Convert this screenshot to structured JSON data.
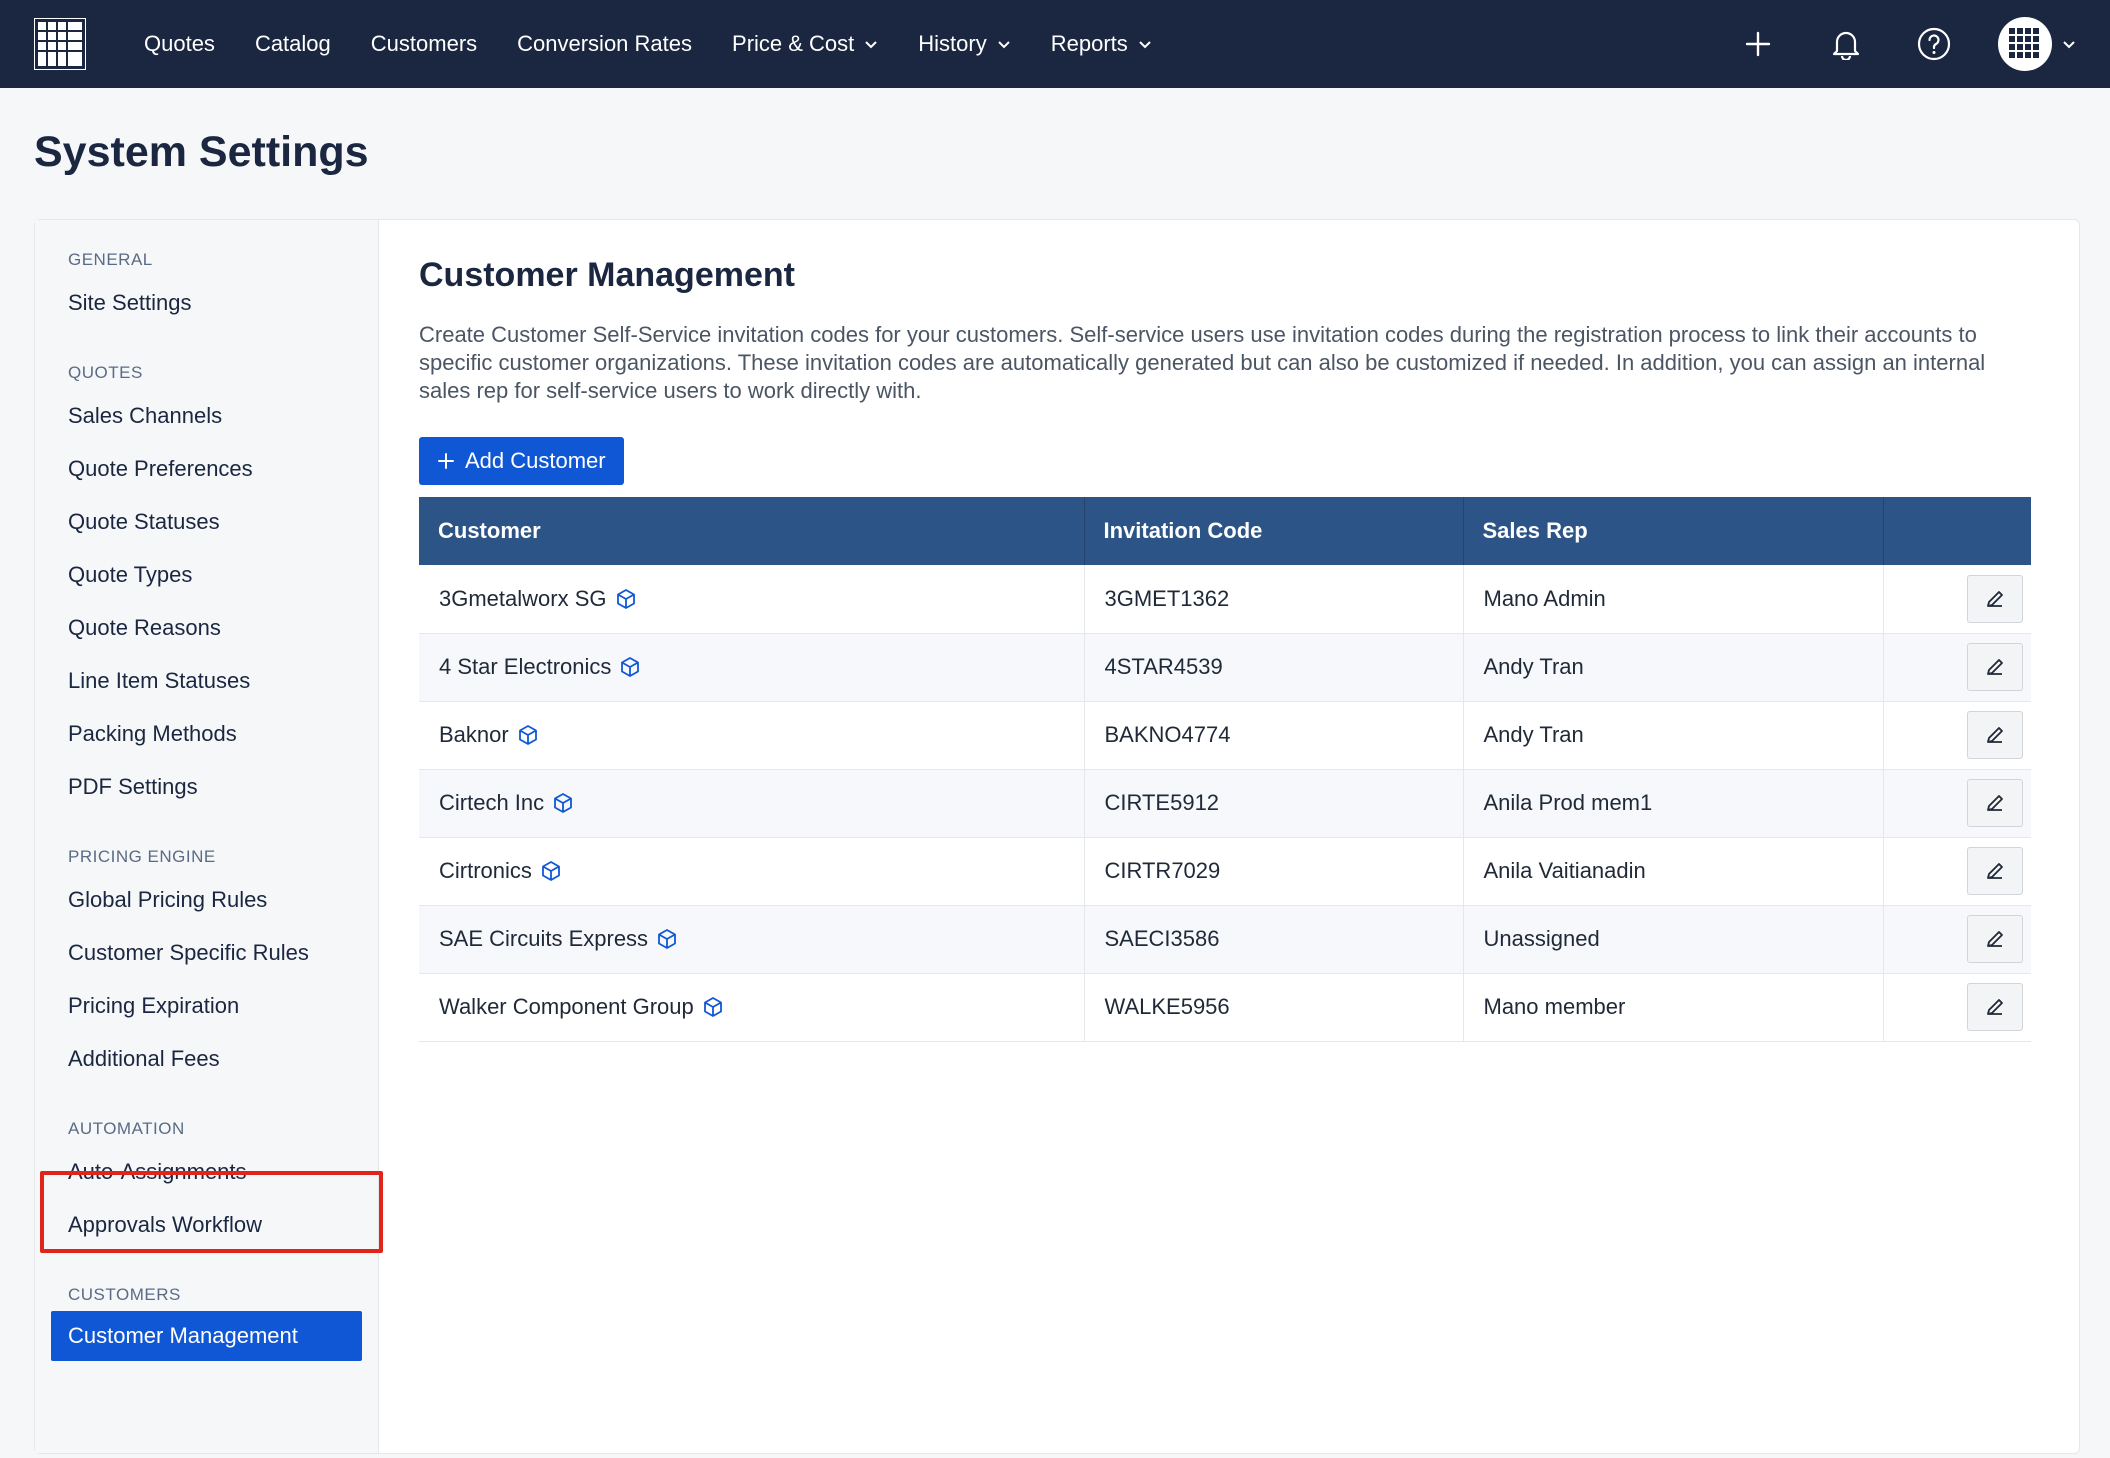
{
  "nav": {
    "items": [
      {
        "label": "Quotes",
        "dropdown": false
      },
      {
        "label": "Catalog",
        "dropdown": false
      },
      {
        "label": "Customers",
        "dropdown": false
      },
      {
        "label": "Conversion Rates",
        "dropdown": false
      },
      {
        "label": "Price & Cost",
        "dropdown": true
      },
      {
        "label": "History",
        "dropdown": true
      },
      {
        "label": "Reports",
        "dropdown": true
      }
    ],
    "icons": [
      "plus-icon",
      "bell-icon",
      "help-icon"
    ]
  },
  "page": {
    "title": "System Settings"
  },
  "sidebar": {
    "sections": [
      {
        "heading": "GENERAL",
        "items": [
          "Site Settings"
        ]
      },
      {
        "heading": "QUOTES",
        "items": [
          "Sales Channels",
          "Quote Preferences",
          "Quote Statuses",
          "Quote Types",
          "Quote Reasons",
          "Line Item Statuses",
          "Packing Methods",
          "PDF Settings"
        ]
      },
      {
        "heading": "PRICING ENGINE",
        "items": [
          "Global Pricing Rules",
          "Customer Specific Rules",
          "Pricing Expiration",
          "Additional Fees"
        ]
      },
      {
        "heading": "AUTOMATION",
        "items": [
          "Auto-Assignments",
          "Approvals Workflow"
        ]
      },
      {
        "heading": "CUSTOMERS",
        "items": [
          "Customer Management"
        ]
      }
    ],
    "active": "Customer Management"
  },
  "main": {
    "title": "Customer Management",
    "description": "Create Customer Self-Service invitation codes for your customers. Self-service users use invitation codes during the registration process to link their accounts to specific customer organizations. These invitation codes are automatically generated but can also be customized if needed. In addition, you can assign an internal sales rep for self-service users to work directly with.",
    "add_button": "Add Customer",
    "table": {
      "headers": [
        "Customer",
        "Invitation Code",
        "Sales Rep",
        ""
      ],
      "rows": [
        {
          "customer": "3Gmetalworx SG",
          "code": "3GMET1362",
          "rep": "Mano Admin"
        },
        {
          "customer": "4 Star Electronics",
          "code": "4STAR4539",
          "rep": "Andy Tran"
        },
        {
          "customer": "Baknor",
          "code": "BAKNO4774",
          "rep": "Andy Tran"
        },
        {
          "customer": "Cirtech Inc",
          "code": "CIRTE5912",
          "rep": "Anila Prod mem1"
        },
        {
          "customer": "Cirtronics",
          "code": "CIRTR7029",
          "rep": "Anila Vaitianadin"
        },
        {
          "customer": "SAE Circuits Express",
          "code": "SAECI3586",
          "rep": "Unassigned"
        },
        {
          "customer": "Walker Component Group",
          "code": "WALKE5956",
          "rep": "Mano member"
        }
      ]
    }
  },
  "colors": {
    "nav_bg": "#1b2740",
    "primary": "#1057d6",
    "table_header": "#2d5487",
    "highlight_outline": "#e1251b"
  }
}
